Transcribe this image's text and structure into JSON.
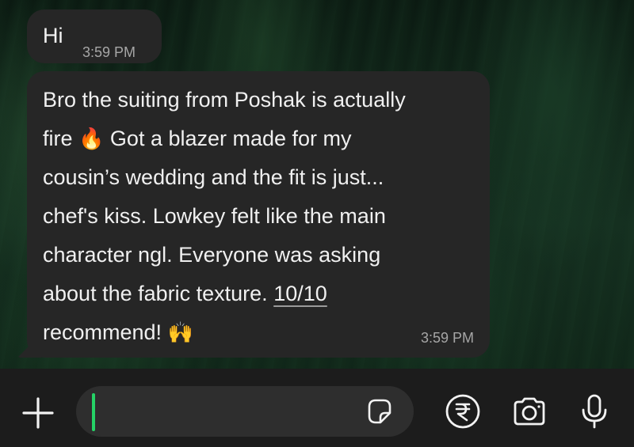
{
  "messages": [
    {
      "text": "Hi",
      "time": "3:59 PM"
    },
    {
      "lines": [
        "Bro the suiting from Poshak is actually",
        "fire",
        "Got a blazer made for my",
        "cousin’s wedding and the fit is just...",
        "chef's kiss. Lowkey felt like the main",
        "character ngl. Everyone was asking",
        "about the fabric texture.",
        "10/10",
        "recommend!"
      ],
      "emoji_fire": "🔥",
      "emoji_hands": "🙌",
      "time": "3:59 PM"
    }
  ],
  "composer": {
    "value": "",
    "caret_color": "#25d366",
    "icons": [
      "plus-icon",
      "sticker-icon",
      "rupee-icon",
      "camera-icon",
      "microphone-icon"
    ]
  }
}
